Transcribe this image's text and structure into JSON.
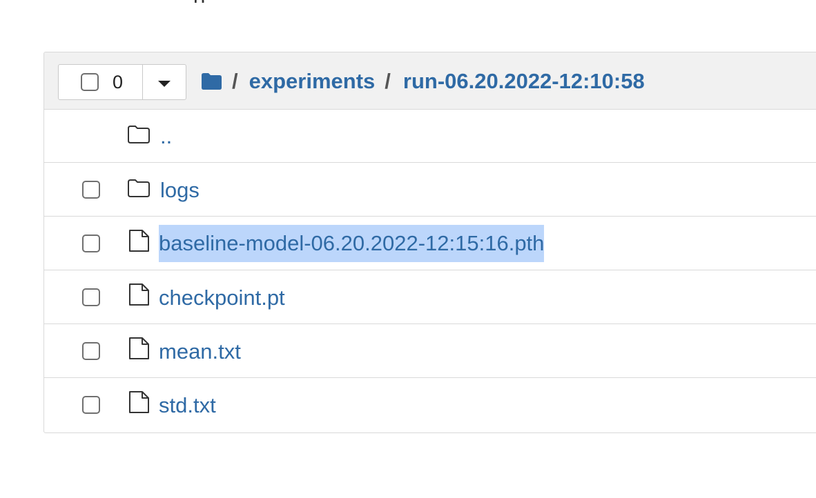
{
  "toolbar": {
    "selected_count": "0"
  },
  "breadcrumb": {
    "separator": "/",
    "items": [
      {
        "label": "experiments"
      },
      {
        "label": "run-06.20.2022-12:10:58"
      }
    ]
  },
  "file_list": [
    {
      "name": "..",
      "type": "parent-folder",
      "selected_text": false
    },
    {
      "name": "logs",
      "type": "folder",
      "selected_text": false
    },
    {
      "name": "baseline-model-06.20.2022-12:15:16.pth",
      "type": "file",
      "selected_text": true
    },
    {
      "name": "checkpoint.pt",
      "type": "file",
      "selected_text": false
    },
    {
      "name": "mean.txt",
      "type": "file",
      "selected_text": false
    },
    {
      "name": "std.txt",
      "type": "file",
      "selected_text": false
    }
  ],
  "colors": {
    "link": "#2f6aa5",
    "header_bg": "#f1f1f1",
    "selection": "#bcd6fb",
    "border": "#d9d9d9"
  },
  "icons": {
    "root": "folder-solid-icon",
    "folder": "folder-outline-icon",
    "file": "file-outline-icon"
  }
}
